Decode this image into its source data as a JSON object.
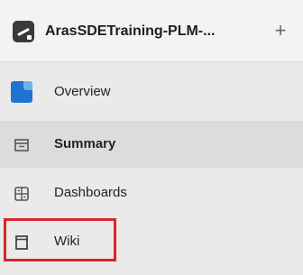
{
  "project": {
    "name": "ArasSDETraining-PLM-...",
    "logo_icon": "project-logo-icon",
    "add_symbol": "+"
  },
  "nav": {
    "items": [
      {
        "label": "Overview",
        "icon": "overview-icon"
      },
      {
        "label": "Summary",
        "icon": "summary-icon",
        "selected": true
      },
      {
        "label": "Dashboards",
        "icon": "dashboards-icon"
      },
      {
        "label": "Wiki",
        "icon": "wiki-icon",
        "highlighted": true
      }
    ]
  },
  "colors": {
    "background": "#eaeaea",
    "selected": "#dcdcdc",
    "accent_blue": "#1f73d1",
    "highlight_red": "#d9252b"
  }
}
